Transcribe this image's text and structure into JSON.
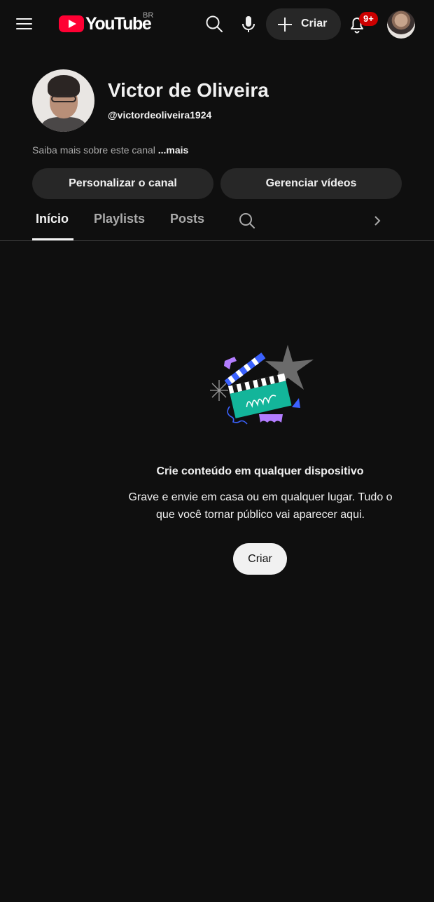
{
  "topbar": {
    "logo_text": "YouTube",
    "logo_country": "BR",
    "create_label": "Criar",
    "notification_count": "9+"
  },
  "channel": {
    "name": "Victor de Oliveira",
    "handle": "@victordeoliveira1924",
    "about_text": "Saiba mais sobre este canal ",
    "about_more": "...mais"
  },
  "actions": {
    "customize_label": "Personalizar o canal",
    "manage_label": "Gerenciar vídeos"
  },
  "tabs": [
    {
      "label": "Início",
      "active": true
    },
    {
      "label": "Playlists",
      "active": false
    },
    {
      "label": "Posts",
      "active": false
    }
  ],
  "empty_state": {
    "title": "Crie conteúdo em qualquer dispositivo",
    "description": "Grave e envie em casa ou em qualquer lugar. Tudo o que você tornar público vai aparecer aqui.",
    "button_label": "Criar"
  },
  "colors": {
    "background": "#0f0f0f",
    "brand_red": "#ff0033",
    "button_dark": "#272727",
    "badge_red": "#cc0000"
  },
  "icons": [
    "menu-icon",
    "search-icon",
    "microphone-icon",
    "plus-icon",
    "bell-icon",
    "chevron-right-icon"
  ]
}
